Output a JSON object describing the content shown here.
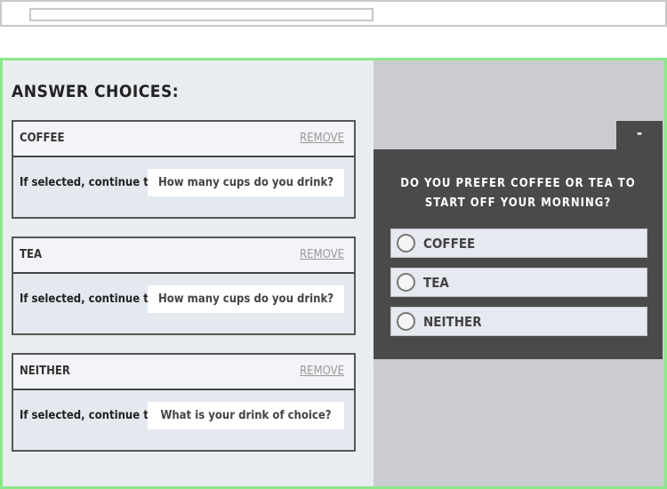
{
  "toolbar": {
    "field_value": ""
  },
  "editor": {
    "title": "ANSWER CHOICES:",
    "choices": [
      {
        "name": "COFFEE",
        "remove": "REMOVE",
        "continue_label": "If selected, continue to:",
        "continue_target": "How many cups do you drink?"
      },
      {
        "name": "TEA",
        "remove": "REMOVE",
        "continue_label": "If selected, continue to:",
        "continue_target": "How many cups do you drink?"
      },
      {
        "name": "NEITHER",
        "remove": "REMOVE",
        "continue_label": "If selected, continue to:",
        "continue_target": "What is your drink of choice?"
      }
    ]
  },
  "preview": {
    "collapse_symbol": "-",
    "question": "DO YOU PREFER COFFEE OR TEA TO START OFF YOUR MORNING?",
    "options": [
      "COFFEE",
      "TEA",
      "NEITHER"
    ]
  }
}
